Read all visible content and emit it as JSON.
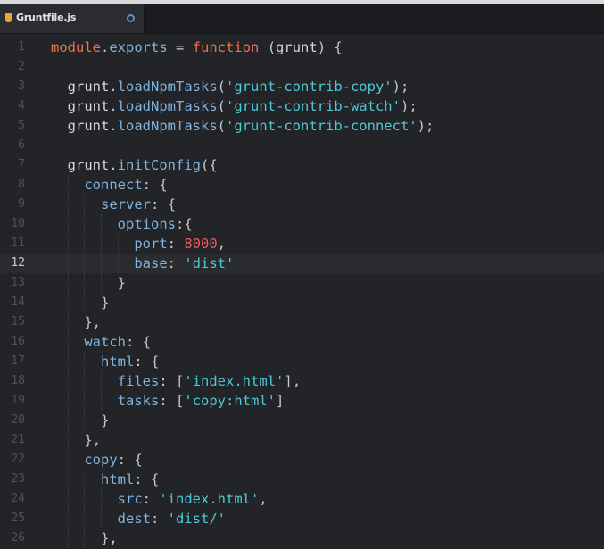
{
  "tab": {
    "filename": "Gruntfile.js",
    "dirty": true
  },
  "editor": {
    "active_line": 12,
    "lines": [
      {
        "n": "1",
        "text": "module.exports = function (grunt) {"
      },
      {
        "n": "2",
        "text": ""
      },
      {
        "n": "3",
        "text": "  grunt.loadNpmTasks('grunt-contrib-copy');"
      },
      {
        "n": "4",
        "text": "  grunt.loadNpmTasks('grunt-contrib-watch');"
      },
      {
        "n": "5",
        "text": "  grunt.loadNpmTasks('grunt-contrib-connect');"
      },
      {
        "n": "6",
        "text": ""
      },
      {
        "n": "7",
        "text": "  grunt.initConfig({"
      },
      {
        "n": "8",
        "text": "    connect: {"
      },
      {
        "n": "9",
        "text": "      server: {"
      },
      {
        "n": "10",
        "text": "        options:{"
      },
      {
        "n": "11",
        "text": "          port: 8000,"
      },
      {
        "n": "12",
        "text": "          base: 'dist'"
      },
      {
        "n": "13",
        "text": "        }"
      },
      {
        "n": "14",
        "text": "      }"
      },
      {
        "n": "15",
        "text": "    },"
      },
      {
        "n": "16",
        "text": "    watch: {"
      },
      {
        "n": "17",
        "text": "      html: {"
      },
      {
        "n": "18",
        "text": "        files: ['index.html'],"
      },
      {
        "n": "19",
        "text": "        tasks: ['copy:html']"
      },
      {
        "n": "20",
        "text": "      }"
      },
      {
        "n": "21",
        "text": "    },"
      },
      {
        "n": "22",
        "text": "    copy: {"
      },
      {
        "n": "23",
        "text": "      html: {"
      },
      {
        "n": "24",
        "text": "        src: 'index.html',"
      },
      {
        "n": "25",
        "text": "        dest: 'dist/'"
      },
      {
        "n": "26",
        "text": "      },"
      }
    ]
  }
}
